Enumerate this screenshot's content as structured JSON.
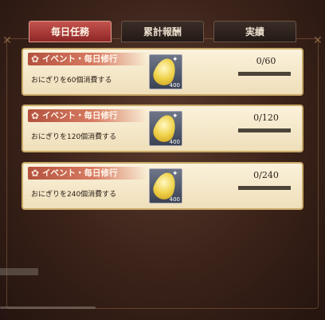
{
  "tabs": [
    {
      "label": "毎日任務",
      "active": true
    },
    {
      "label": "累計報酬",
      "active": false
    },
    {
      "label": "実績",
      "active": false
    }
  ],
  "quests": [
    {
      "category": "イベント・毎日修行",
      "description": "おにぎりを60個消費する",
      "reward_icon": "golden-leaf-icon",
      "reward_count": "400",
      "progress_text": "0/60",
      "progress_fraction": 0
    },
    {
      "category": "イベント・毎日修行",
      "description": "おにぎりを120個消費する",
      "reward_icon": "golden-leaf-icon",
      "reward_count": "400",
      "progress_text": "0/120",
      "progress_fraction": 0
    },
    {
      "category": "イベント・毎日修行",
      "description": "おにぎりを240個消費する",
      "reward_icon": "golden-leaf-icon",
      "reward_count": "400",
      "progress_text": "0/240",
      "progress_fraction": 0
    }
  ],
  "colors": {
    "active_tab": "#b23a36",
    "card_bg": "#f6ead0",
    "card_border": "#c9a968",
    "label_bg": "#c0604a",
    "progress_track": "#4c4438"
  }
}
